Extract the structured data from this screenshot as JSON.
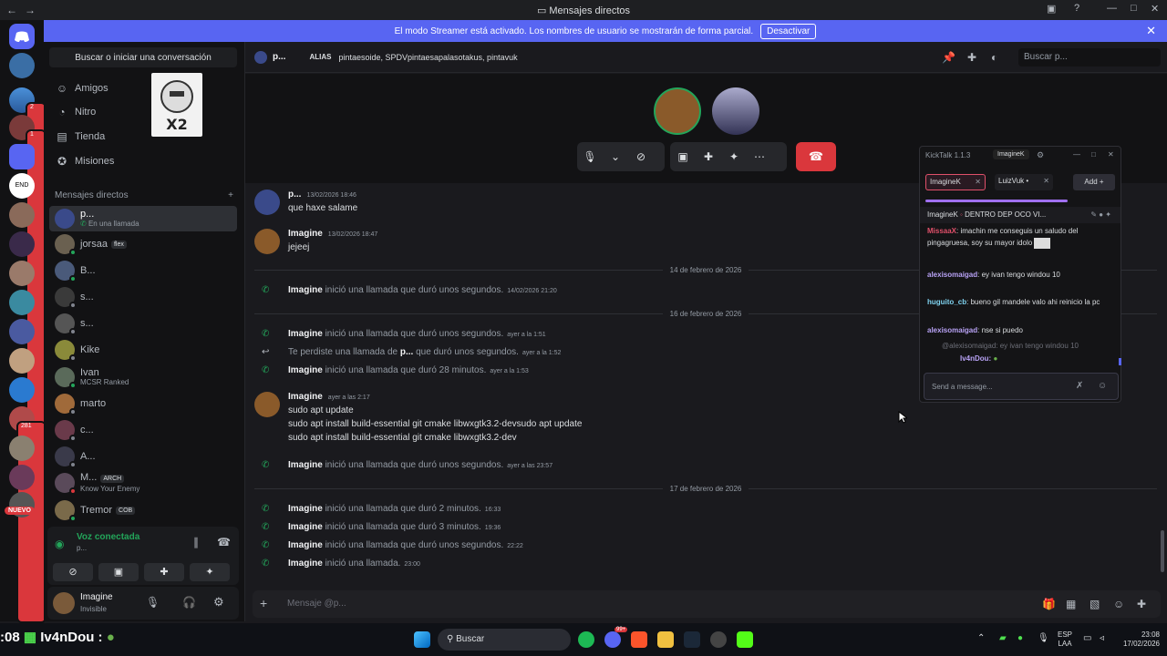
{
  "window": {
    "title": "Mensajes directos",
    "back": "←",
    "forward": "→"
  },
  "banner": {
    "text": "El modo Streamer está activado. Los nombres de usuario se mostrarán de forma parcial.",
    "button": "Desactivar"
  },
  "guilds": {
    "badges": [
      "2",
      "1",
      "281"
    ],
    "new_label": "NUEVO"
  },
  "sidebar": {
    "search": "Buscar o iniciar una conversación",
    "nav": [
      {
        "label": "Amigos"
      },
      {
        "label": "Nitro"
      },
      {
        "label": "Tienda"
      },
      {
        "label": "Misiones"
      }
    ],
    "sticker_text": "X2",
    "dm_header": "Mensajes directos",
    "dm_add": "+",
    "dms": [
      {
        "name": "p...",
        "sub": "En una llamada",
        "tag": ""
      },
      {
        "name": "jorsaa",
        "sub": "",
        "tag": "flex"
      },
      {
        "name": "B...",
        "sub": "",
        "tag": ""
      },
      {
        "name": "s...",
        "sub": "",
        "tag": ""
      },
      {
        "name": "s...",
        "sub": "",
        "tag": ""
      },
      {
        "name": "Kike",
        "sub": "",
        "tag": ""
      },
      {
        "name": "Ivan",
        "sub": "MCSR Ranked",
        "tag": ""
      },
      {
        "name": "marto",
        "sub": "",
        "tag": ""
      },
      {
        "name": "c...",
        "sub": "",
        "tag": ""
      },
      {
        "name": "A...",
        "sub": "",
        "tag": ""
      },
      {
        "name": "M...",
        "sub": "Know Your Enemy",
        "tag": "ARCH"
      },
      {
        "name": "Tremor",
        "sub": "",
        "tag": "COB"
      }
    ],
    "voice": {
      "status": "Voz conectada",
      "channel": "p..."
    },
    "user": {
      "name": "Imagine",
      "status": "Invisible"
    }
  },
  "chat": {
    "header": {
      "name": "p...",
      "alias_label": "ALIAS",
      "aliases": "pintaesoide, SPDVpintaesapalasotakus, pintavuk",
      "search_placeholder": "Buscar p..."
    },
    "messages": [
      {
        "author": "p...",
        "time": "13/02/2026 18:46",
        "lines": [
          "que haxe salame"
        ]
      },
      {
        "author": "Imagine",
        "time": "13/02/2026 18:47",
        "lines": [
          "jejeej"
        ]
      },
      {
        "author": "Imagine",
        "time": "ayer a las 2:17",
        "lines": [
          "sudo apt update",
          "sudo apt install build-essential git cmake libwxgtk3.2-devsudo apt update",
          "sudo apt install build-essential git cmake libwxgtk3.2-dev"
        ]
      }
    ],
    "dividers": [
      "14 de febrero de 2026",
      "16 de febrero de 2026",
      "17 de febrero de 2026"
    ],
    "sys_text": "inició una llamada que duró unos segundos.",
    "calls": [
      {
        "who": "Imagine",
        "text": "inició una llamada que duró unos segundos.",
        "time": "14/02/2026 21:20"
      },
      {
        "who": "Imagine",
        "text": "inició una llamada que duró unos segundos.",
        "time": "ayer a la 1:51"
      },
      {
        "who": "",
        "text": "Te perdiste una llamada de",
        "who2": "p...",
        "text2": "que duró unos segundos.",
        "time": "ayer a la 1:52"
      },
      {
        "who": "Imagine",
        "text": "inició una llamada que duró 28 minutos.",
        "time": "ayer a la 1:53"
      },
      {
        "who": "Imagine",
        "text": "inició una llamada que duró unos segundos.",
        "time": "ayer a las 23:57"
      },
      {
        "who": "Imagine",
        "text": "inició una llamada que duró 2 minutos.",
        "time": "16:33"
      },
      {
        "who": "Imagine",
        "text": "inició una llamada que duró 3 minutos.",
        "time": "19:36"
      },
      {
        "who": "Imagine",
        "text": "inició una llamada que duró unos segundos.",
        "time": "22:22"
      },
      {
        "who": "Imagine",
        "text": "inició una llamada.",
        "time": "23:00"
      }
    ],
    "composer_placeholder": "Mensaje @p..."
  },
  "kicktalk": {
    "title": "KickTalk 1.1.3",
    "user": "ImagineK",
    "tabs": [
      {
        "label": "ImagineK"
      },
      {
        "label": "LuizVuk •"
      }
    ],
    "add": "Add",
    "stream_user": "ImagineK",
    "stream_title": "DENTRO DEP OCO VI...",
    "messages": [
      {
        "user": "MissaaX",
        "text": "imachin me conseguis un saludo del pingagruesa, soy su mayor idolo",
        "color": "#e0506a"
      },
      {
        "user": "alexisomaigad",
        "text": "ey ivan tengo windou 10",
        "color": "#b8a2f5"
      },
      {
        "user": "huguito_cb",
        "text": "bueno gil mandele valo ahi reinicio la pc",
        "color": "#7fd3f0"
      },
      {
        "user": "alexisomaigad",
        "text": "nse si puedo",
        "color": "#b8a2f5"
      }
    ],
    "reply_preview": "@alexisomaigad: ey ivan tengo windou 10",
    "last_user": "Iv4nDou:",
    "input_placeholder": "Send a message..."
  },
  "overlay": {
    "time_fragment": ":08",
    "name": "Iv4nDou :"
  },
  "taskbar": {
    "search": "Buscar",
    "lang": "ESP",
    "lang2": "LAA",
    "time": "23:08",
    "date": "17/02/2026",
    "badge": "99+"
  }
}
